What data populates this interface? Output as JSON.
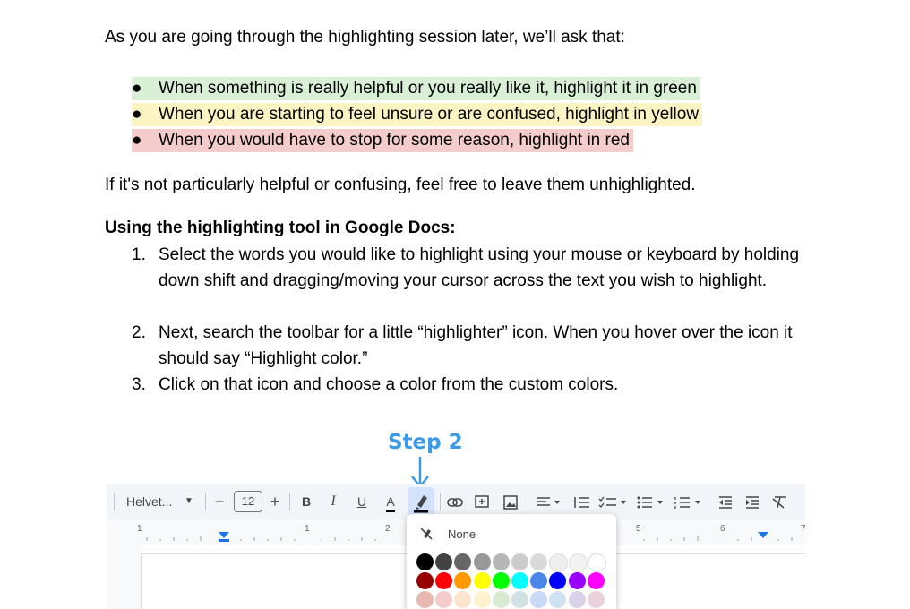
{
  "intro": "As you are going through the highlighting session later, we’ll ask that:",
  "bullets": [
    {
      "text": "When something is really helpful or you really like it, highlight it in green",
      "color": "#d9f0d6"
    },
    {
      "text": "When you are starting to feel unsure or are confused, highlight in yellow",
      "color": "#fcf4c2"
    },
    {
      "text": "When you would have to stop for some reason, highlight in red",
      "color": "#f5cccc"
    }
  ],
  "bullet_glyph": "●",
  "unhighlighted_note": "If it's not particularly helpful or confusing, feel free to leave them unhighlighted.",
  "tool_heading": "Using the highlighting tool in Google Docs:",
  "steps": [
    {
      "n": "1.",
      "text": "Select the words you would like to highlight using your mouse or keyboard by holding down shift and dragging/moving your cursor across the text you wish to highlight."
    },
    {
      "n": "2.",
      "text": "Next, search the toolbar for a little “highlighter” icon. When you hover over the icon it should say “Highlight color.”"
    },
    {
      "n": "3.",
      "text": "Click on that icon and choose a color from the custom colors."
    }
  ],
  "screenshot": {
    "step_label": "Step 2",
    "accent_color": "#3b9ae8",
    "toolbar": {
      "font": "Helvet...",
      "font_size": "12",
      "bold": "B",
      "italic": "I",
      "underline": "U",
      "text_color": "A",
      "minus": "−",
      "plus": "+"
    },
    "ruler_numbers": [
      "1",
      "1",
      "2",
      "5",
      "6",
      "7"
    ],
    "highlight_menu": {
      "none_label": "None",
      "swatch_rows": [
        [
          "#000000",
          "#434343",
          "#666666",
          "#999999",
          "#b7b7b7",
          "#cccccc",
          "#d9d9d9",
          "#efefef",
          "#f3f3f3",
          "#ffffff"
        ],
        [
          "#980000",
          "#ff0000",
          "#ff9900",
          "#ffff00",
          "#00ff00",
          "#00ffff",
          "#4a86e8",
          "#0000ff",
          "#9900ff",
          "#ff00ff"
        ],
        [
          "#e6b8af",
          "#f4cccc",
          "#fce5cd",
          "#fff2cc",
          "#d9ead3",
          "#d0e0e3",
          "#c9daf8",
          "#cfe2f3",
          "#d9d2e9",
          "#ead1dc"
        ]
      ]
    }
  }
}
